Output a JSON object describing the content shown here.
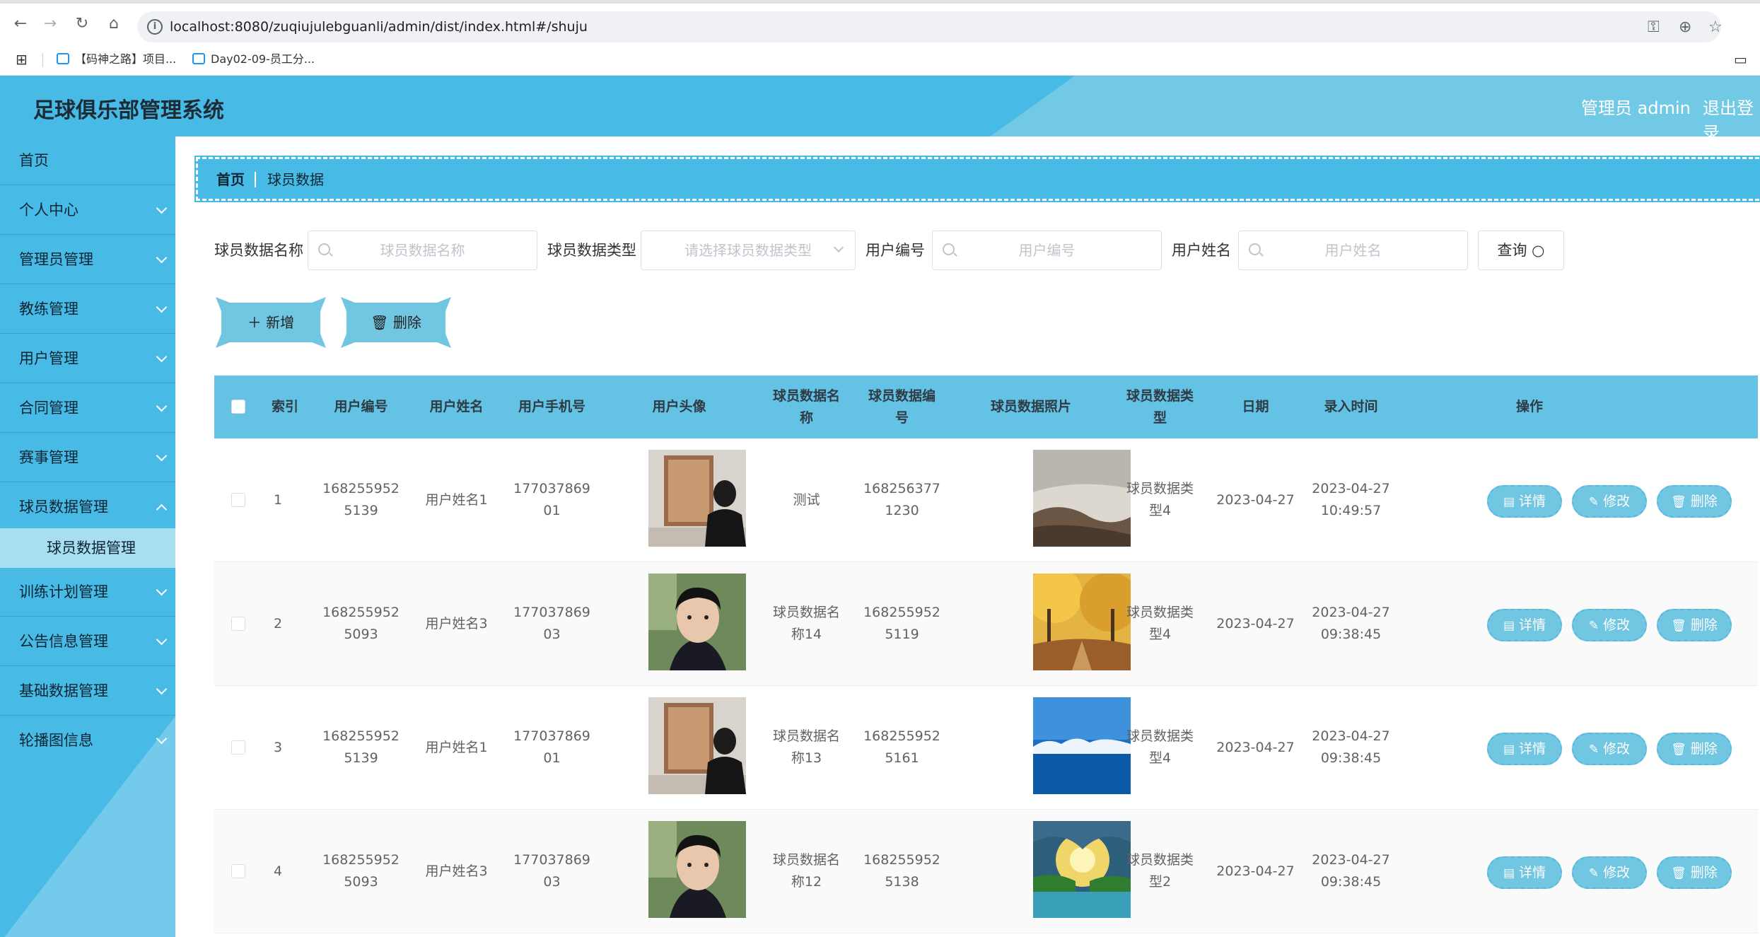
{
  "browser": {
    "url": "localhost:8080/zuqiujulebguanli/admin/dist/index.html#/shuju",
    "bookmarks": [
      "【码神之路】项目...",
      "Day02-09-员工分..."
    ]
  },
  "header": {
    "title": "足球俱乐部管理系统",
    "user": "管理员 admin",
    "logout": "退出登录"
  },
  "sidebar": {
    "items": [
      {
        "label": "首页"
      },
      {
        "label": "个人中心"
      },
      {
        "label": "管理员管理"
      },
      {
        "label": "教练管理"
      },
      {
        "label": "用户管理"
      },
      {
        "label": "合同管理"
      },
      {
        "label": "赛事管理"
      },
      {
        "label": "球员数据管理"
      },
      {
        "label": "训练计划管理"
      },
      {
        "label": "公告信息管理"
      },
      {
        "label": "基础数据管理"
      },
      {
        "label": "轮播图信息"
      }
    ],
    "sub_item": "球员数据管理"
  },
  "breadcrumb": {
    "home": "首页",
    "current": "球员数据"
  },
  "filters": {
    "name_label": "球员数据名称",
    "name_placeholder": "球员数据名称",
    "type_label": "球员数据类型",
    "type_placeholder": "请选择球员数据类型",
    "userno_label": "用户编号",
    "userno_placeholder": "用户编号",
    "username_label": "用户姓名",
    "username_placeholder": "用户姓名",
    "query": "查询"
  },
  "actions": {
    "add": "新增",
    "delete": "删除"
  },
  "table": {
    "headers": {
      "index": "索引",
      "userno": "用户编号",
      "username": "用户姓名",
      "phone": "用户手机号",
      "avatar": "用户头像",
      "dname": [
        "球员数据名",
        "称"
      ],
      "dno": [
        "球员数据编",
        "号"
      ],
      "photo": "球员数据照片",
      "dtype": [
        "球员数据类",
        "型"
      ],
      "date": "日期",
      "time": "录入时间",
      "ops": "操作"
    },
    "ops": {
      "detail": "详情",
      "edit": "修改",
      "delete": "删除"
    },
    "rows": [
      {
        "index": "1",
        "userno": [
          "168255952",
          "5139"
        ],
        "username": "用户姓名1",
        "phone": [
          "177037869",
          "01"
        ],
        "dname": [
          "测试",
          ""
        ],
        "dno": [
          "168256377",
          "1230"
        ],
        "dtype": [
          "球员数据类",
          "型4"
        ],
        "date": "2023-04-27",
        "time": [
          "2023-04-27",
          "10:49:57"
        ]
      },
      {
        "index": "2",
        "userno": [
          "168255952",
          "5093"
        ],
        "username": "用户姓名3",
        "phone": [
          "177037869",
          "03"
        ],
        "dname": [
          "球员数据名",
          "称14"
        ],
        "dno": [
          "168255952",
          "5119"
        ],
        "dtype": [
          "球员数据类",
          "型4"
        ],
        "date": "2023-04-27",
        "time": [
          "2023-04-27",
          "09:38:45"
        ]
      },
      {
        "index": "3",
        "userno": [
          "168255952",
          "5139"
        ],
        "username": "用户姓名1",
        "phone": [
          "177037869",
          "01"
        ],
        "dname": [
          "球员数据名",
          "称13"
        ],
        "dno": [
          "168255952",
          "5161"
        ],
        "dtype": [
          "球员数据类",
          "型4"
        ],
        "date": "2023-04-27",
        "time": [
          "2023-04-27",
          "09:38:45"
        ]
      },
      {
        "index": "4",
        "userno": [
          "168255952",
          "5093"
        ],
        "username": "用户姓名3",
        "phone": [
          "177037869",
          "03"
        ],
        "dname": [
          "球员数据名",
          "称12"
        ],
        "dno": [
          "168255952",
          "5138"
        ],
        "dtype": [
          "球员数据类",
          "型2"
        ],
        "date": "2023-04-27",
        "time": [
          "2023-04-27",
          "09:38:45"
        ]
      }
    ]
  },
  "colors": {
    "primary": "#47bae5",
    "button": "#71c6e2"
  }
}
